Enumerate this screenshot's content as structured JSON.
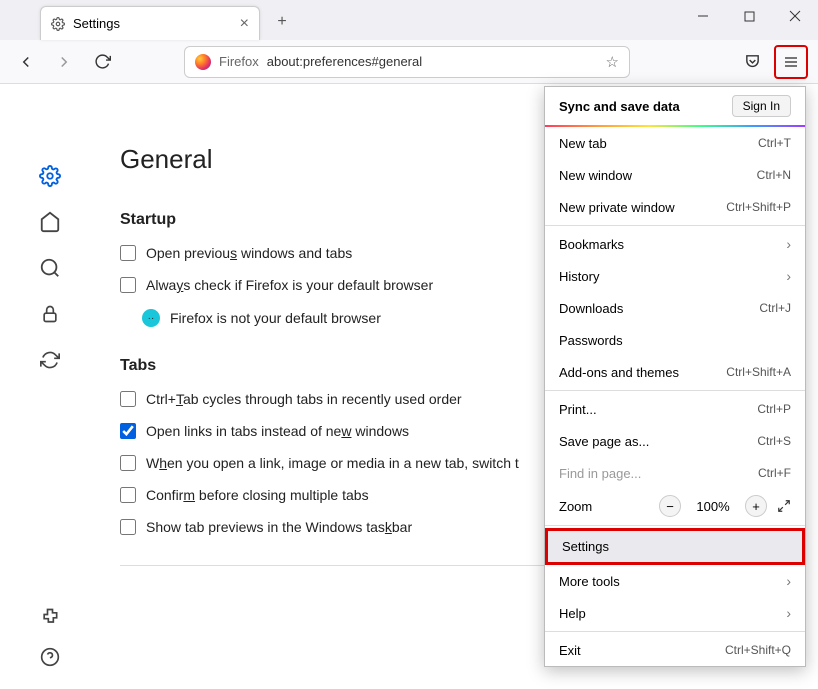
{
  "tab": {
    "title": "Settings"
  },
  "address": {
    "prefix": "Firefox",
    "url": "about:preferences#general"
  },
  "page": {
    "heading": "General",
    "startup": {
      "title": "Startup",
      "open_prev": [
        "Open previou",
        "s",
        " windows and tabs"
      ],
      "always_check": [
        "Alwa",
        "y",
        "s check if Firefox is your default browser"
      ],
      "not_default": "Firefox is not your default browser"
    },
    "tabs": {
      "title": "Tabs",
      "ctrl_tab": [
        "Ctrl+",
        "T",
        "ab cycles through tabs in recently used order"
      ],
      "open_links": [
        "Open links in tabs instead of ne",
        "w",
        " windows"
      ],
      "when_open": [
        "W",
        "h",
        "en you open a link, image or media in a new tab, switch t"
      ],
      "confirm": [
        "Confir",
        "m",
        " before closing multiple tabs"
      ],
      "show_previews": [
        "Show tab previews in the Windows tas",
        "k",
        "bar"
      ]
    }
  },
  "menu": {
    "sync_header": "Sync and save data",
    "sign_in": "Sign In",
    "new_tab": {
      "label": "New tab",
      "shortcut": "Ctrl+T"
    },
    "new_window": {
      "label": "New window",
      "shortcut": "Ctrl+N"
    },
    "new_private": {
      "label": "New private window",
      "shortcut": "Ctrl+Shift+P"
    },
    "bookmarks": "Bookmarks",
    "history": "History",
    "downloads": {
      "label": "Downloads",
      "shortcut": "Ctrl+J"
    },
    "passwords": "Passwords",
    "addons": {
      "label": "Add-ons and themes",
      "shortcut": "Ctrl+Shift+A"
    },
    "print": {
      "label": "Print...",
      "shortcut": "Ctrl+P"
    },
    "save_as": {
      "label": "Save page as...",
      "shortcut": "Ctrl+S"
    },
    "find": {
      "label": "Find in page...",
      "shortcut": "Ctrl+F"
    },
    "zoom": {
      "label": "Zoom",
      "value": "100%"
    },
    "settings": "Settings",
    "more_tools": "More tools",
    "help": "Help",
    "exit": {
      "label": "Exit",
      "shortcut": "Ctrl+Shift+Q"
    }
  }
}
